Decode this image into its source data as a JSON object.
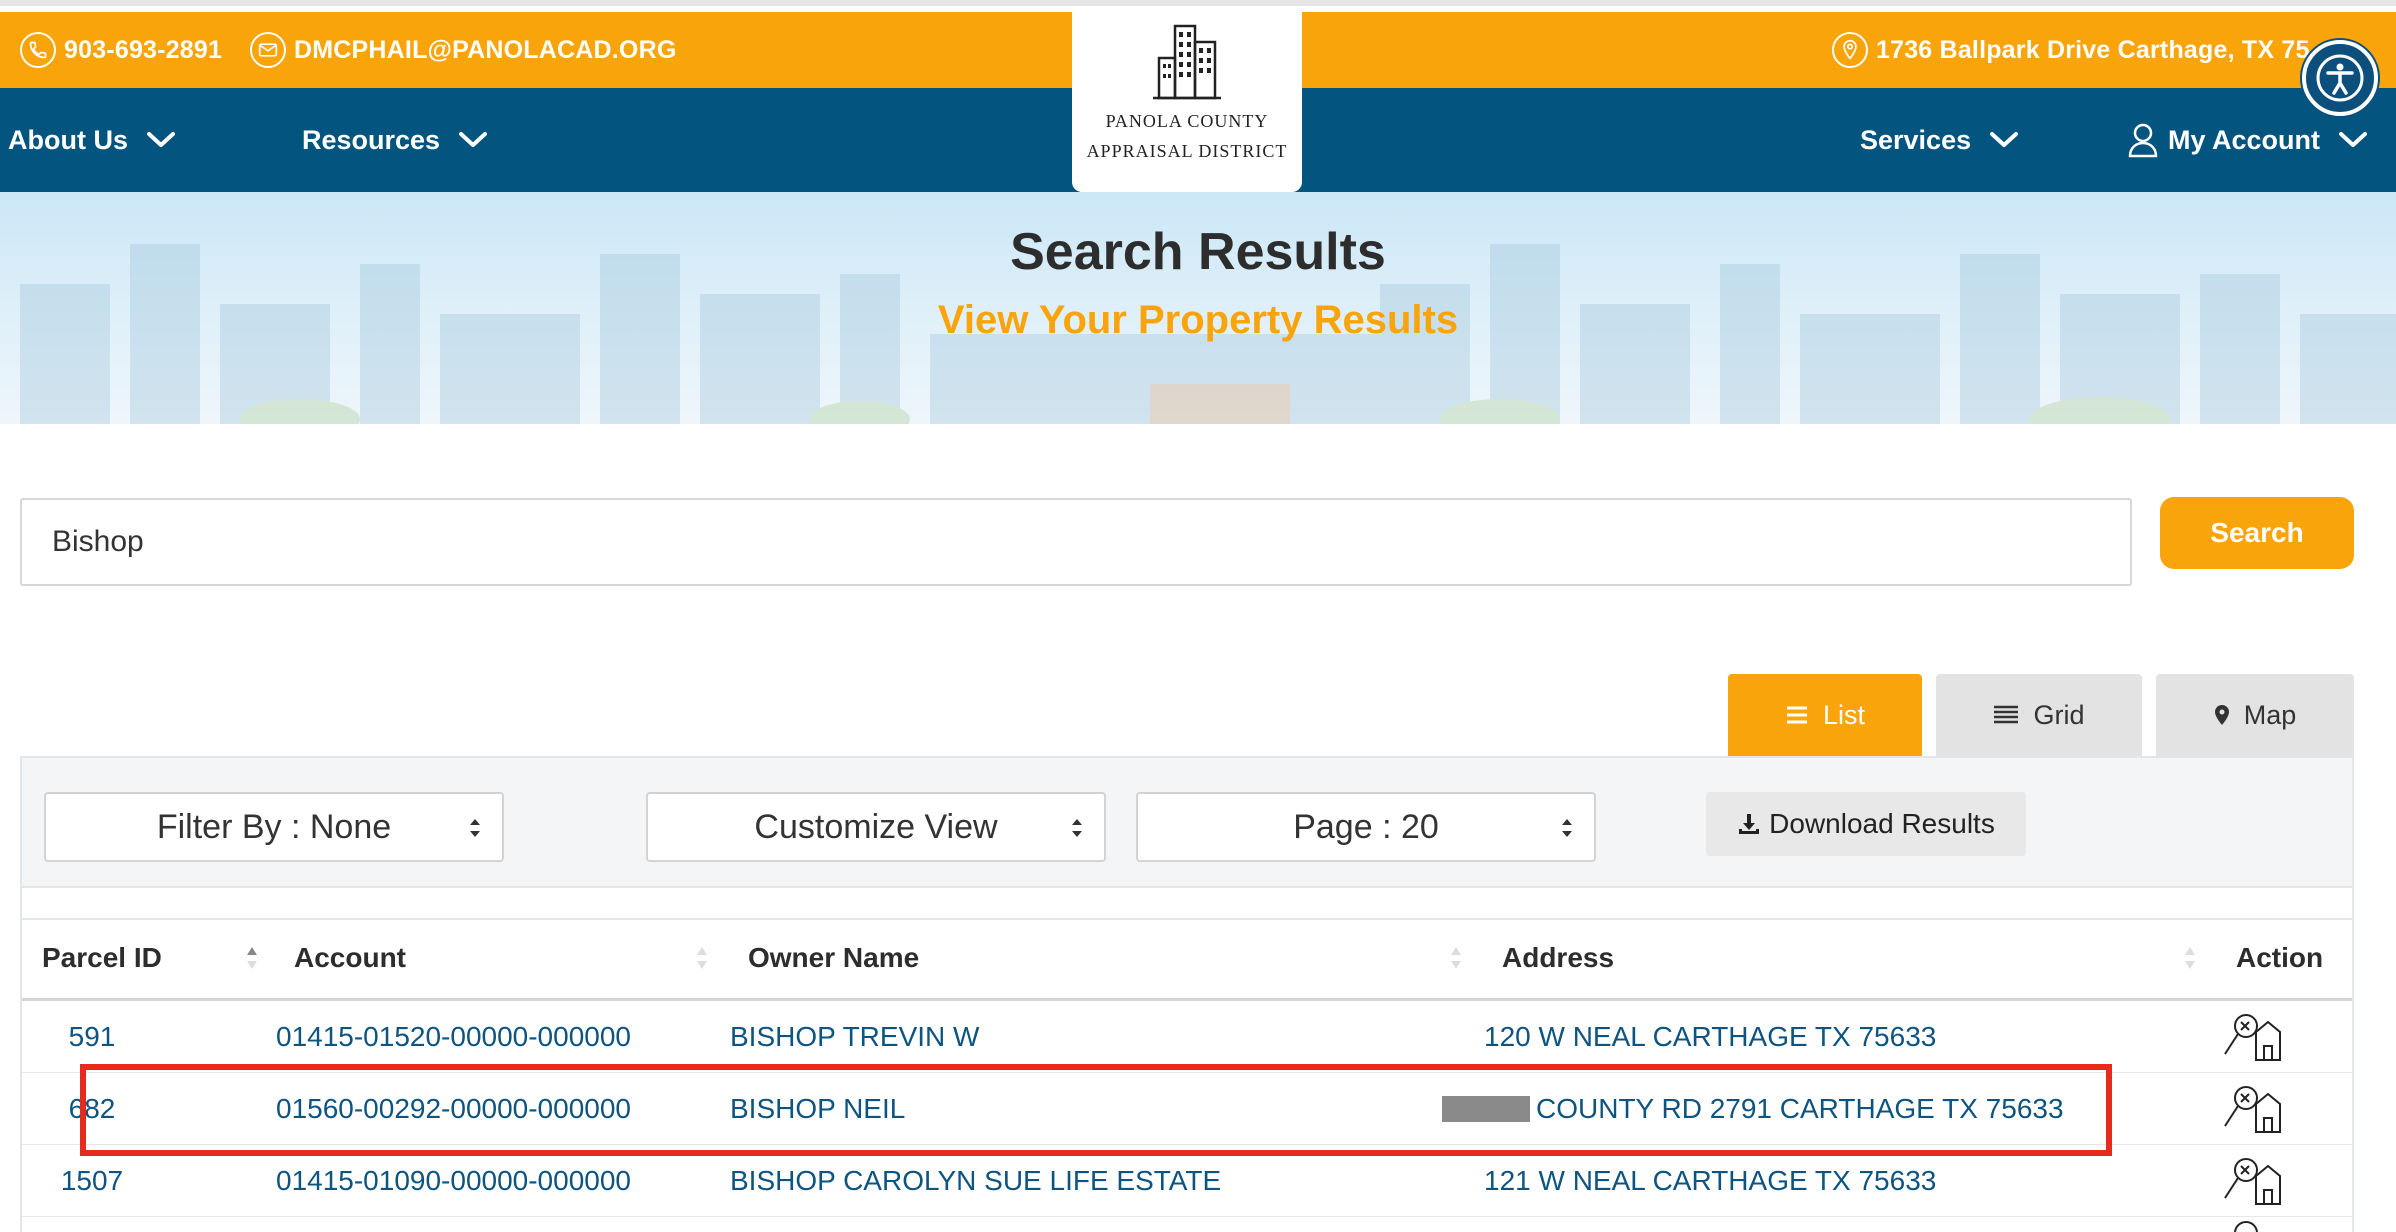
{
  "contact": {
    "phone": "903-693-2891",
    "email": "DMCPHAIL@PANOLACAD.ORG",
    "address": "1736 Ballpark Drive Carthage, TX 75"
  },
  "logo": {
    "line1": "PANOLA COUNTY",
    "line2": "APPRAISAL DISTRICT"
  },
  "nav": {
    "about": "About Us",
    "resources": "Resources",
    "services": "Services",
    "account": "My Account"
  },
  "hero": {
    "title": "Search Results",
    "subtitle": "View Your Property Results"
  },
  "search": {
    "value": "Bishop",
    "button": "Search"
  },
  "views": {
    "list": "List",
    "grid": "Grid",
    "map": "Map",
    "active": "list"
  },
  "controls": {
    "filter": "Filter By : None",
    "customize": "Customize View",
    "page": "Page : 20",
    "download": "Download Results"
  },
  "table": {
    "headers": {
      "parcel": "Parcel ID",
      "account": "Account",
      "owner": "Owner Name",
      "address": "Address",
      "action": "Action"
    },
    "rows": [
      {
        "parcel": "591",
        "account": "01415-01520-00000-000000",
        "owner": "BISHOP TREVIN W",
        "address": "120 W NEAL CARTHAGE TX 75633"
      },
      {
        "parcel": "682",
        "account": "01560-00292-00000-000000",
        "owner": "BISHOP NEIL",
        "address": "COUNTY RD 2791 CARTHAGE TX 75633"
      },
      {
        "parcel": "1507",
        "account": "01415-01090-00000-000000",
        "owner": "BISHOP CAROLYN SUE LIFE ESTATE",
        "address": "121 W NEAL CARTHAGE TX 75633"
      }
    ]
  },
  "colors": {
    "orange": "#f9a40a",
    "navy": "#03547f",
    "link": "#0e5481",
    "highlight": "#e62b1e"
  },
  "icons": {
    "phone": "phone-icon",
    "email": "envelope-icon",
    "address": "location-pin-icon",
    "accessibility": "accessibility-icon",
    "action": "property-search-icon"
  }
}
